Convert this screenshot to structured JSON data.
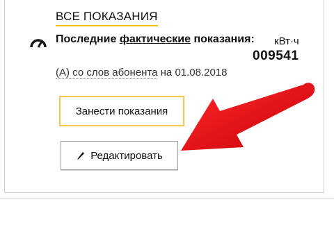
{
  "header": {
    "all_readings_label": "ВСЕ ПОКАЗАНИЯ"
  },
  "readings": {
    "last_prefix": "Последние ",
    "last_factual": "фактические",
    "last_suffix": " показания:",
    "unit": "кВт·ч",
    "value": "009541",
    "source_link": "(А) со слов абонента",
    "source_date": " на 01.08.2018"
  },
  "actions": {
    "enter_label": "Занести показания",
    "edit_label": "Редактировать"
  },
  "colors": {
    "accent_yellow": "#f2c94c",
    "annotation_red": "#e8101a"
  },
  "icons": {
    "gauge": "gauge-icon",
    "pencil": "pencil-icon"
  }
}
